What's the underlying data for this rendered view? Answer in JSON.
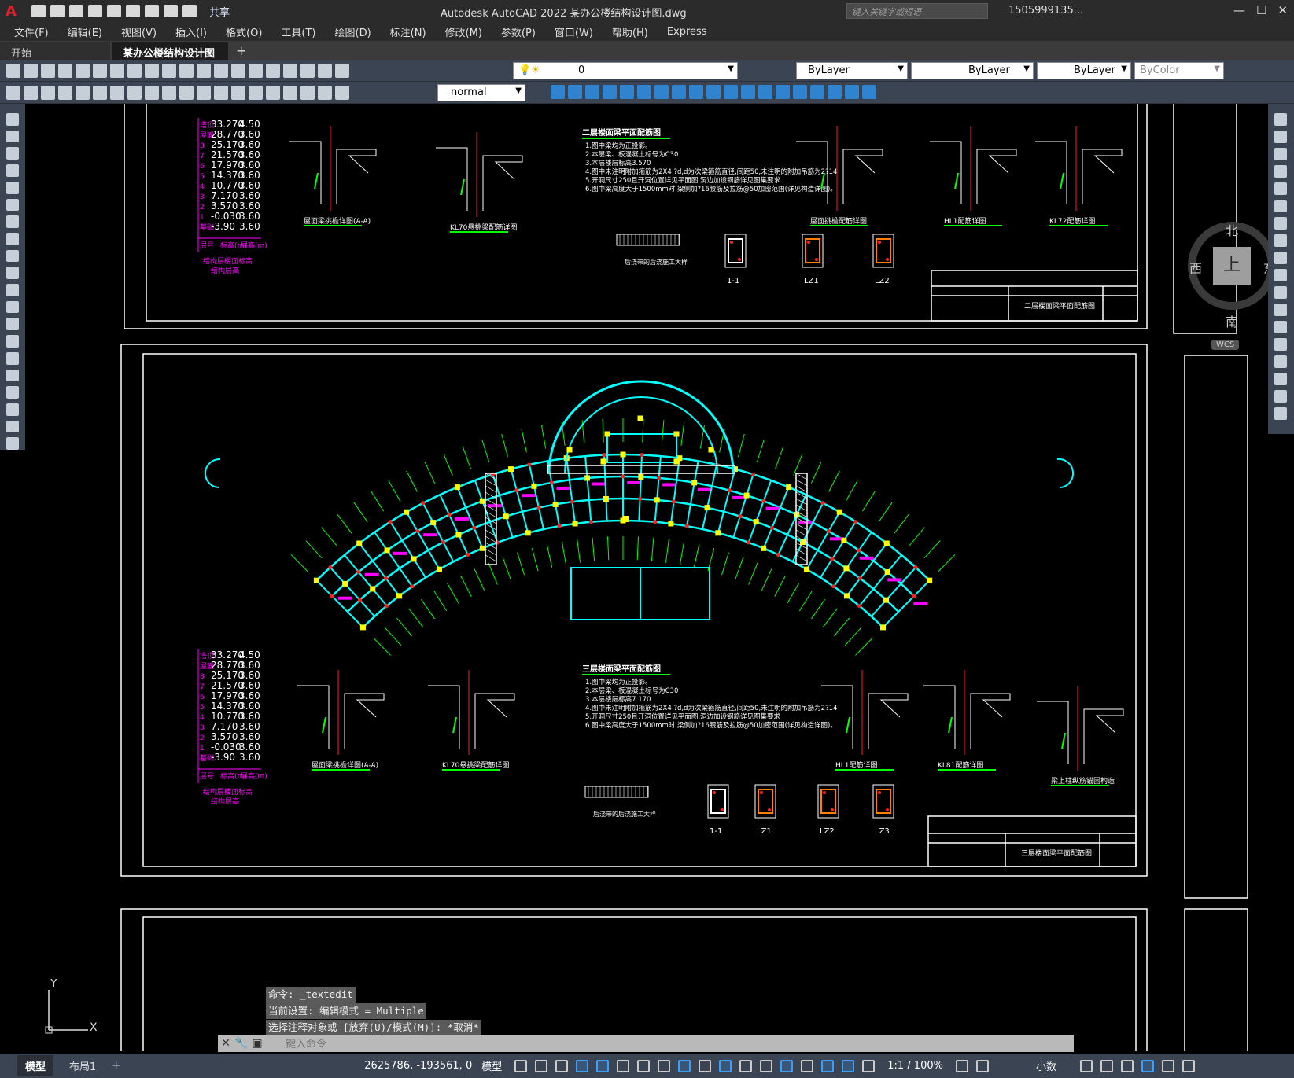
{
  "title_bar": {
    "app_logo": "A",
    "share_label": "共享",
    "title": "Autodesk AutoCAD 2022    某办公楼结构设计图.dwg",
    "search_placeholder": "键入关键字或短语",
    "user": "1505999135..."
  },
  "menu": [
    "文件(F)",
    "编辑(E)",
    "视图(V)",
    "插入(I)",
    "格式(O)",
    "工具(T)",
    "绘图(D)",
    "标注(N)",
    "修改(M)",
    "参数(P)",
    "窗口(W)",
    "帮助(H)",
    "Express"
  ],
  "tabs": {
    "start": "开始",
    "active": "某办公楼结构设计图*",
    "close": "×",
    "add": "+"
  },
  "toolbar": {
    "layer_value": "0",
    "color": "ByLayer",
    "linetype": "ByLayer",
    "lineweight": "ByLayer",
    "plotstyle": "ByColor",
    "textstyle": "normal"
  },
  "viewcube": {
    "north": "北",
    "south": "南",
    "east": "东",
    "west": "西",
    "face": "上",
    "wcs": "WCS"
  },
  "drawing": {
    "elev_table_rows": [
      {
        "floor": "塔顶",
        "elev": "33.270",
        "height": "4.50"
      },
      {
        "floor": "屋面",
        "elev": "28.770",
        "height": "3.60"
      },
      {
        "floor": "8",
        "elev": "25.170",
        "height": "3.60"
      },
      {
        "floor": "7",
        "elev": "21.570",
        "height": "3.60"
      },
      {
        "floor": "6",
        "elev": "17.970",
        "height": "3.60"
      },
      {
        "floor": "5",
        "elev": "14.370",
        "height": "3.60"
      },
      {
        "floor": "4",
        "elev": "10.770",
        "height": "3.60"
      },
      {
        "floor": "3",
        "elev": "7.170",
        "height": "3.60"
      },
      {
        "floor": "2",
        "elev": "3.570",
        "height": "3.60"
      },
      {
        "floor": "1",
        "elev": "-0.030",
        "height": "3.60"
      },
      {
        "floor": "基础",
        "elev": "-3.90",
        "height": "3.60"
      }
    ],
    "elev_table_footer": [
      "层号",
      "标高(m)",
      "层高(m)"
    ],
    "elev_table_caption": "结构层楼面标高",
    "elev_table_caption2": "结构层高",
    "top_sheet_title": "二层楼面梁平面配筋图",
    "mid_sheet_title": "三层楼面梁平面配筋图",
    "top_notes": [
      "1.图中梁均为正投影。",
      "2.本层梁、板混凝土标号为C30",
      "3.本层楼层标高3.570",
      "4.图中未注明附加箍筋为2X4 ?d,d为次梁箍筋直径,间距50,未注明的附加吊筋为2?14",
      "5.开洞尺寸250且开洞位置详见平面图,洞边加设钢筋详见图集要求",
      "6.图中梁高度大于1500mm时,梁侧加?16腰筋及拉筋@50加密范围(详见构造详图)。"
    ],
    "mid_notes": [
      "1.图中梁均为正投影。",
      "2.本层梁、板混凝土标号为C30",
      "3.本层楼层标高7.170",
      "4.图中未注明附加箍筋为2X4 ?d,d为次梁箍筋直径,间距50,未注明的附加吊筋为2?14",
      "5.开洞尺寸250且开洞位置详见平面图,洞边加设钢筋详见图集要求",
      "6.图中梁高度大于1500mm时,梁侧加?16腰筋及拉筋@50加密范围(详见构造详图)。"
    ],
    "top_details": [
      "屋面梁挑檐详图(A-A)",
      "KL70悬挑梁配筋详图",
      "屋面挑檐配筋详图",
      "HL1配筋详图",
      "KL72配筋详图"
    ],
    "mid_details": [
      "屋面梁挑檐详图(A-A)",
      "KL70悬挑梁配筋详图",
      "HL1配筋详图",
      "KL81配筋详图",
      "梁上柱纵筋锚固构造"
    ],
    "column_labels": [
      "1-1",
      "LZ1",
      "LZ2",
      "LZ3"
    ],
    "joint_label": "后浇带的后浇施工大样"
  },
  "command": {
    "history": [
      "命令: _textedit",
      "当前设置: 编辑模式 = Multiple",
      "选择注释对象或 [放弃(U)/模式(M)]: *取消*"
    ],
    "placeholder": "键入命令"
  },
  "status": {
    "model_tab": "模型",
    "layout_tab": "布局1",
    "coords": "2625786, -193561, 0",
    "model_label": "模型",
    "scale": "1:1 / 100%",
    "units": "小数"
  },
  "colors": {
    "cyan": "#00ffff",
    "magenta": "#ff00ff",
    "yellow": "#ffff00",
    "green": "#00ff00",
    "red": "#ff2020"
  }
}
